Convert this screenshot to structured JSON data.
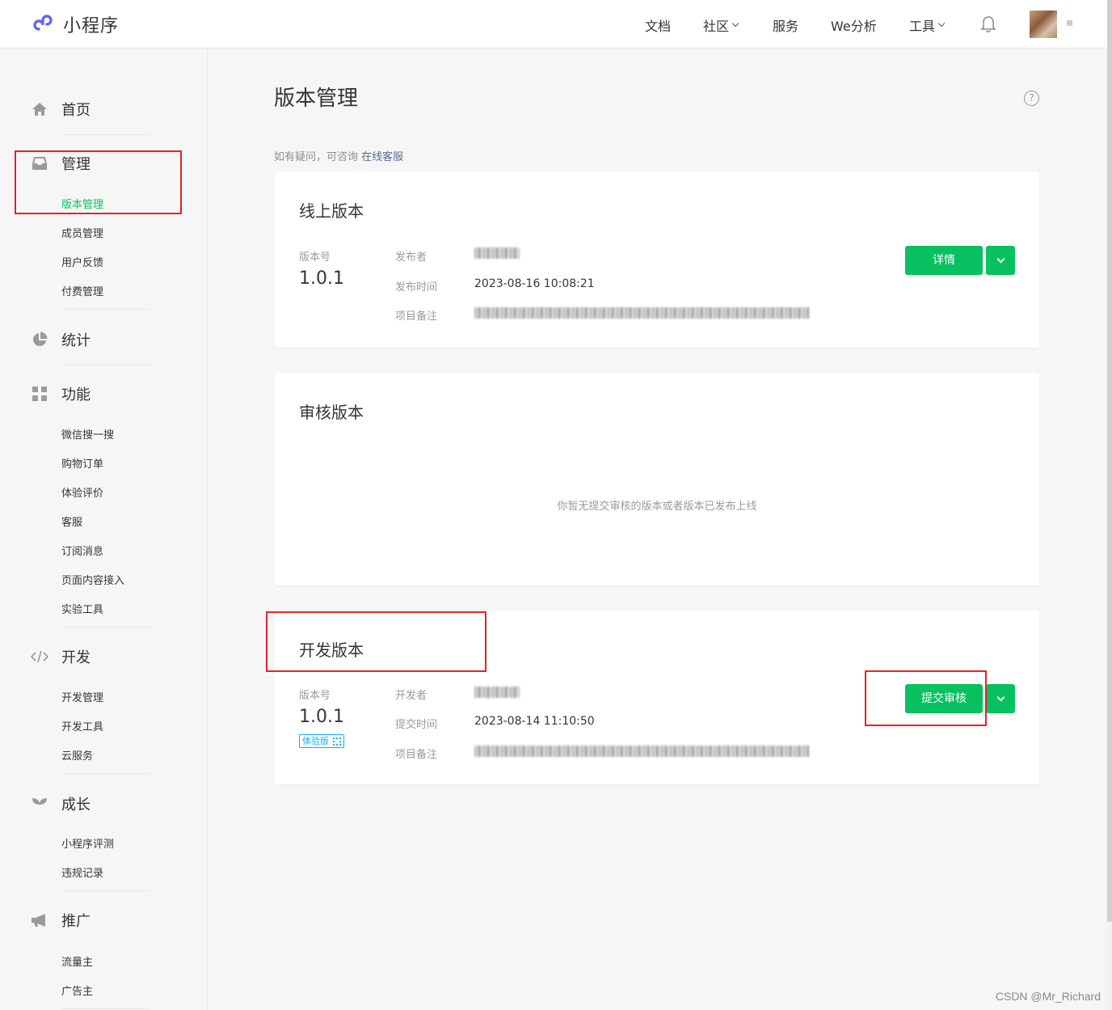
{
  "header": {
    "logo_text": "小程序",
    "nav": [
      {
        "label": "文档",
        "dropdown": false
      },
      {
        "label": "社区",
        "dropdown": true
      },
      {
        "label": "服务",
        "dropdown": false
      },
      {
        "label": "We分析",
        "dropdown": false
      },
      {
        "label": "工具",
        "dropdown": true
      }
    ],
    "bell_icon": "bell-icon",
    "accent_color": "#07c160"
  },
  "sidebar": {
    "home": "首页",
    "manage": {
      "title": "管理",
      "items": [
        "版本管理",
        "成员管理",
        "用户反馈",
        "付费管理"
      ],
      "active": "版本管理"
    },
    "stats": "统计",
    "features": {
      "title": "功能",
      "items": [
        "微信搜一搜",
        "购物订单",
        "体验评价",
        "客服",
        "订阅消息",
        "页面内容接入",
        "实验工具"
      ]
    },
    "dev": {
      "title": "开发",
      "items": [
        "开发管理",
        "开发工具",
        "云服务"
      ]
    },
    "growth": {
      "title": "成长",
      "items": [
        "小程序评测",
        "违规记录"
      ]
    },
    "promo": {
      "title": "推广",
      "items": [
        "流量主",
        "广告主"
      ]
    }
  },
  "main": {
    "title": "版本管理",
    "hint_prefix": "如有疑问，可咨询",
    "hint_link": "在线客服",
    "online": {
      "title": "线上版本",
      "version_label": "版本号",
      "version": "1.0.1",
      "publisher_label": "发布者",
      "publish_time_label": "发布时间",
      "publish_time": "2023-08-16 10:08:21",
      "remark_label": "项目备注",
      "detail_button": "详情"
    },
    "review": {
      "title": "审核版本",
      "empty": "你暂无提交审核的版本或者版本已发布上线"
    },
    "dev": {
      "title": "开发版本",
      "version_label": "版本号",
      "version": "1.0.1",
      "tag": "体验版",
      "developer_label": "开发者",
      "submit_time_label": "提交时间",
      "submit_time": "2023-08-14 11:10:50",
      "remark_label": "项目备注",
      "submit_button": "提交审核"
    }
  },
  "watermark": "CSDN @Mr_Richard"
}
